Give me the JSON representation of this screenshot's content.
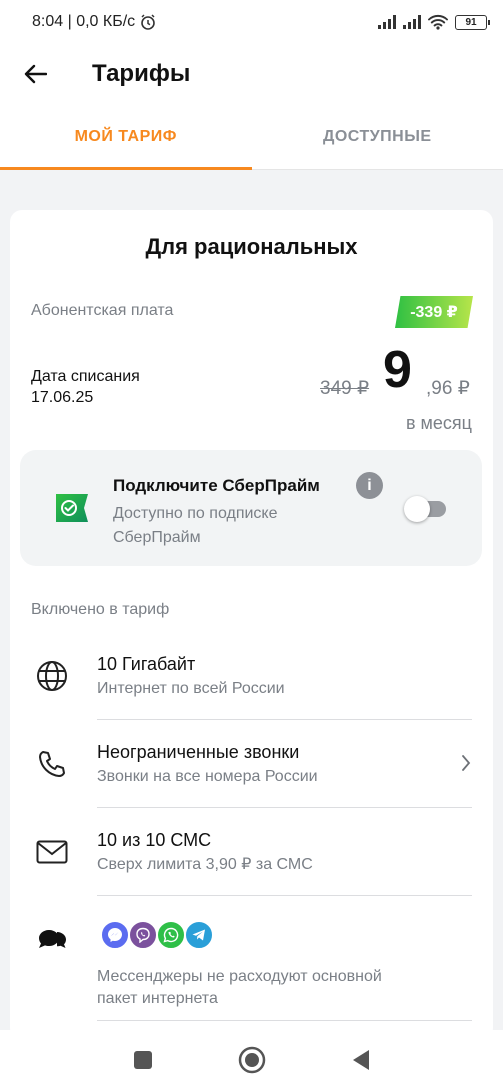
{
  "status_bar": {
    "time_speed": "8:04 | 0,0 КБ/с",
    "battery": "91"
  },
  "app_bar": {
    "title": "Тарифы"
  },
  "tabs": [
    {
      "label": "МОЙ ТАРИФ",
      "active": true
    },
    {
      "label": "ДОСТУПНЫЕ",
      "active": false
    }
  ],
  "tariff": {
    "name": "Для рациональных",
    "fee_label": "Абонентская плата",
    "discount": "-339 ₽",
    "date_label": "Дата списания",
    "date_value": "17.06.25",
    "old_price": "349 ₽",
    "price_int": "9",
    "price_frac": ",96 ₽",
    "per_month": "в месяц"
  },
  "promo": {
    "title": "Подключите СберПрайм",
    "subtitle": "Доступно по подписке СберПрайм",
    "info_glyph": "i",
    "toggle_on": false
  },
  "included": {
    "label": "Включено в тариф",
    "items": [
      {
        "icon": "globe-icon",
        "title": "10 Гигабайт",
        "subtitle": "Интернет по всей России"
      },
      {
        "icon": "phone-icon",
        "title": "Неограниченные звонки",
        "subtitle": "Звонки на все номера России"
      },
      {
        "icon": "mail-icon",
        "title": "10 из 10 СМС",
        "subtitle": "Сверх лимита 3,90 ₽ за СМС"
      },
      {
        "icon": "chat-bubbles-icon",
        "title": "",
        "subtitle": "Мессенджеры не расходуют основной пакет интернета"
      }
    ],
    "messengers": [
      {
        "icon": "messenger-icon",
        "color": "#5b6cf0"
      },
      {
        "icon": "viber-icon",
        "color": "#7b519d"
      },
      {
        "icon": "whatsapp-icon",
        "color": "#2fbf48"
      },
      {
        "icon": "telegram-icon",
        "color": "#2a9fd8"
      }
    ]
  },
  "colors": {
    "accent": "#f7891f",
    "discount_start": "#2fc043",
    "discount_end": "#b7e54a",
    "muted": "#7a7f86"
  }
}
